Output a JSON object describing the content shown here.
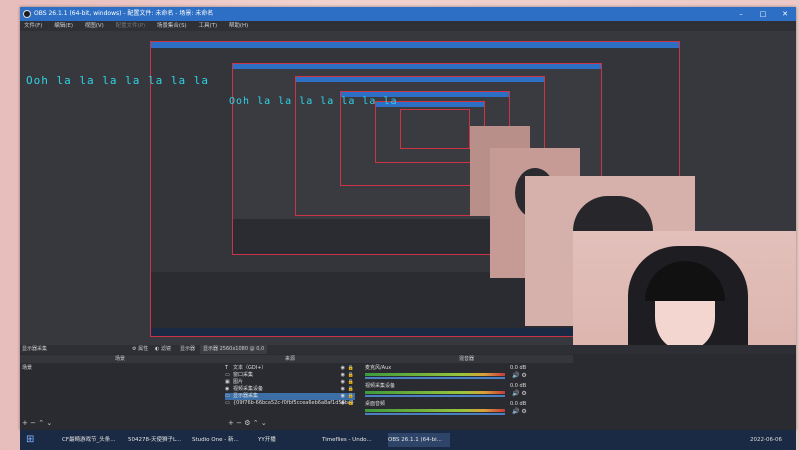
{
  "window": {
    "title": "OBS 26.1.1 (64-bit, windows) - 配置文件: 未命名 - 场景: 未命名"
  },
  "menu": [
    "文件(F)",
    "编辑(E)",
    "视图(V)",
    "配置文件(P)",
    "场景集合(S)",
    "工具(T)",
    "帮助(H)"
  ],
  "overlay_text": "Ooh la la la la la la la",
  "toolbar": {
    "properties": "属性",
    "filters": "滤镜",
    "display_capture": "显示器",
    "display": "显示器",
    "display_value": "2560x1080 @ 0,0"
  },
  "panels": {
    "scenes": "场景",
    "sources": "来源",
    "mixer": "混音器"
  },
  "scene_list_label": "显示器采集",
  "scene_item": "场景",
  "sources": [
    {
      "icon": "T",
      "name": "文本（GDI+）"
    },
    {
      "icon": "▭",
      "name": "窗口采集"
    },
    {
      "icon": "▣",
      "name": "图片"
    },
    {
      "icon": "◉",
      "name": "视频采集设备"
    },
    {
      "icon": "▭",
      "name": "显示器采集"
    },
    {
      "icon": "▭",
      "name": "{09f76b-66bca52c-f0fbf5ccea6eb6a8af1d56ba}"
    }
  ],
  "mixer": [
    {
      "name": "麦克风/Aux",
      "db": "0.0 dB"
    },
    {
      "name": "视频采集设备",
      "db": "0.0 dB"
    },
    {
      "name": "桌面音频",
      "db": "0.0 dB"
    }
  ],
  "mixer_db_extra": "-1.6 dB",
  "side": {
    "label1": "可以",
    "label2": "持续",
    "value": "300 ms"
  },
  "taskbar": [
    {
      "label": "CF最畸游戏节_头条..."
    },
    {
      "label": "504278-天使狮子L..."
    },
    {
      "label": "Studio One - 新..."
    },
    {
      "label": "YY开播"
    },
    {
      "label": "Timeflies - Undo..."
    },
    {
      "label": "OBS 26.1.1 (64-bi..."
    }
  ],
  "clock": "2022-06-06",
  "colors": {
    "titlebar": "#2d6fc4",
    "overlay": "#2fd3e6",
    "red_border": "#cc3344"
  }
}
